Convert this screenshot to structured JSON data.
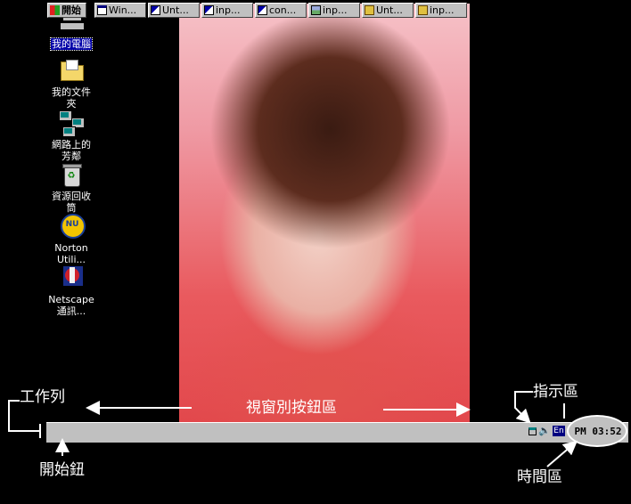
{
  "desktop": {
    "icons": [
      {
        "label": "我的電腦",
        "icon": "my-computer-icon",
        "selected": true
      },
      {
        "label": "我的文件\n夾",
        "icon": "folder-icon"
      },
      {
        "label": "網路上的\n芳鄰",
        "icon": "network-neighborhood-icon"
      },
      {
        "label": "資源回收\n筒",
        "icon": "recycle-bin-icon"
      },
      {
        "label": "Norton\nUtili...",
        "icon": "norton-utilities-icon"
      },
      {
        "label": "Netscape\n通訊...",
        "icon": "netscape-icon"
      }
    ]
  },
  "taskbar": {
    "start_label": "開始",
    "buttons": [
      {
        "label": "Win...",
        "icon": "window-icon"
      },
      {
        "label": "Unt...",
        "icon": "paint-icon"
      },
      {
        "label": "inp...",
        "icon": "paint-icon"
      },
      {
        "label": "con...",
        "icon": "paint-icon"
      },
      {
        "label": "inp...",
        "icon": "image-icon"
      },
      {
        "label": "Unt...",
        "icon": "document-icon"
      },
      {
        "label": "inp...",
        "icon": "document-icon"
      }
    ],
    "tray": {
      "lang": "En",
      "clock": "PM 03:52"
    }
  },
  "annotations": {
    "taskbar": "工作列",
    "task_buttons": "視窗別按鈕區",
    "indicator": "指示區",
    "start_button": "開始鈕",
    "clock_area": "時間區"
  },
  "colors": {
    "desktop": "#000000",
    "taskbar": "#c0c0c0",
    "selection": "#0000a8"
  }
}
